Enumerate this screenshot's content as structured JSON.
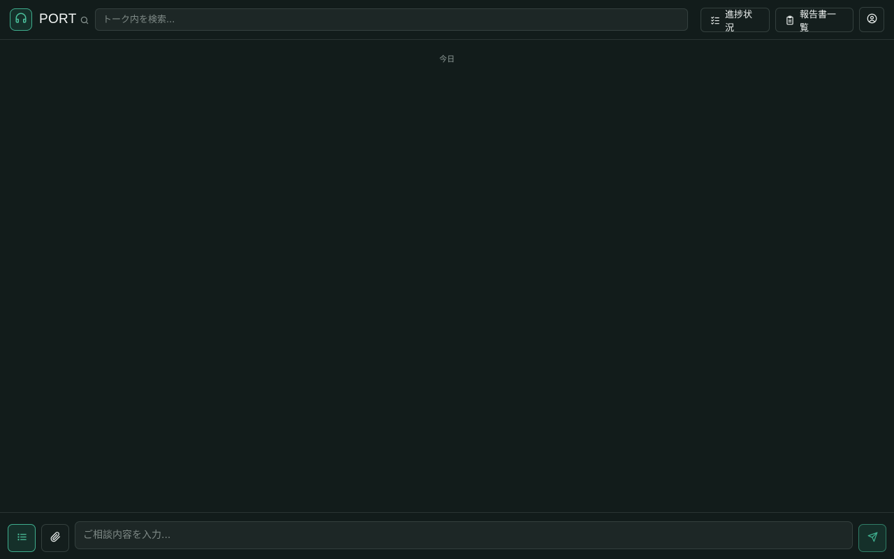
{
  "header": {
    "brand": "PORT",
    "logo_icon": "headset-icon",
    "search": {
      "placeholder": "トーク内を検索...",
      "value": ""
    },
    "progress_button_label": "進捗状況",
    "reports_button_label": "報告書一覧"
  },
  "chat": {
    "date_separator": "今日",
    "messages": []
  },
  "composer": {
    "placeholder": "ご相談内容を入力...",
    "value": ""
  },
  "colors": {
    "background": "#121c1b",
    "accent": "#3fae8e",
    "border": "#34403e"
  }
}
